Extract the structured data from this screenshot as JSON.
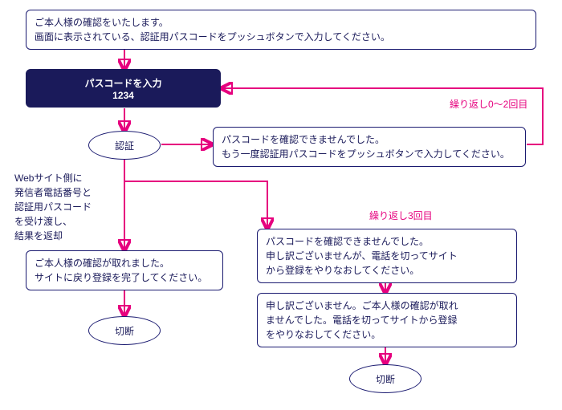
{
  "intro": {
    "line1": "ご本人様の確認をいたします。",
    "line2": "画面に表示されている、認証用パスコードをプッシュボタンで入力してください。"
  },
  "input_step": {
    "title": "パスコードを入力",
    "code": "1234"
  },
  "auth": {
    "label": "認証"
  },
  "retry_0_2_label": "繰り返し0～2回目",
  "retry_3_label": "繰り返し3回目",
  "fail_retry": {
    "line1": "パスコードを確認できませんでした。",
    "line2": "もう一度認証用パスコードをプッシュボタンで入力してください。"
  },
  "side_note": {
    "l1": "Webサイト側に",
    "l2": "発信者電話番号と",
    "l3": "認証用パスコード",
    "l4": "を受け渡し、",
    "l5": "結果を返却"
  },
  "success": {
    "line1": "ご本人様の確認が取れました。",
    "line2": "サイトに戻り登録を完了してください。"
  },
  "fail3": {
    "line1": "パスコードを確認できませんでした。",
    "line2": "申し訳ございませんが、電話を切ってサイト",
    "line3": "から登録をやりなおしてください。"
  },
  "fail_final": {
    "line1": "申し訳ございません。ご本人様の確認が取れ",
    "line2": "ませんでした。電話を切ってサイトから登録",
    "line3": "をやりなおしてください。"
  },
  "disconnect": {
    "label": "切断"
  },
  "colors": {
    "accent": "#e6007e",
    "primary": "#1a1a5a"
  }
}
